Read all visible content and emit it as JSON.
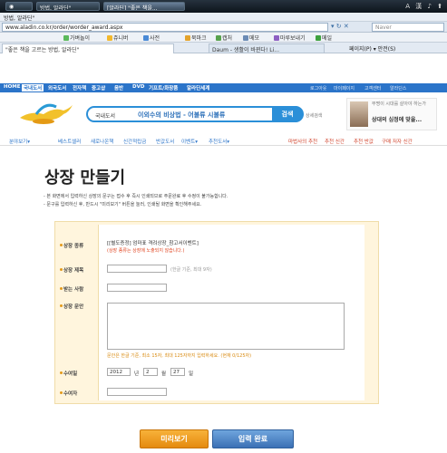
{
  "taskbar": {
    "items": [
      "방법, 알라딘\"",
      "[알라딘] \"좋은 책을..."
    ],
    "tray": "A 漢 ♪ ⬆"
  },
  "browser": {
    "title": "방법, 알라딘\"",
    "url": "www.aladin.co.kr/order/worder_award.aspx",
    "search_engine": "Naver",
    "toolbar": [
      "가벼놀이",
      "쥬니버",
      "사전",
      "북마크",
      "캡처",
      "메모",
      "마루보내기",
      "메일"
    ],
    "tab_active": "\"좋은 책을 고르는 방법, 알라딘\"",
    "tab_2": "Daum - 생활이 바뀐다! Li...",
    "command_bar": "페이지(P) ▾   안전(S)"
  },
  "site": {
    "nav": [
      "HOME",
      "국내도서",
      "외국도서",
      "전자책",
      "중고샵",
      "음반",
      "DVD",
      "기프트/화장품",
      "알라딘세계"
    ],
    "util": [
      "로그아웃",
      "마이페이지",
      "고객센터",
      "알라딘스"
    ],
    "search": {
      "category": "국내도서",
      "query": "이외수의 비상법 - 어불류 시불류",
      "button": "검색",
      "detail": "상세검색"
    },
    "ad": {
      "text": "무명이 시대를 살아야 하는가",
      "title": "상대의 심정에 맞을..."
    },
    "subnav": [
      "분야보기",
      "베스트셀러",
      "새로나온책",
      "신간적립금",
      "반값도서",
      "이벤트",
      "추천도서"
    ],
    "subnav_right": [
      "마법사의 추천",
      "추천 신간",
      "추천 반값",
      "구매 저자 신간"
    ]
  },
  "page": {
    "title": "상장 만들기",
    "notes": [
      "- 본 화면에서 입력하신 상장의 문구는 접수 후 즉시 인쇄되므로 주문완료 후 수정이 불가능합니다.",
      "- 문구를 입력하신 후, 반드시 \"미리보기\" 버튼을 눌러, 인쇄될 화면을 확인해주세요."
    ]
  },
  "form": {
    "type_label": "상장 종류",
    "type_value": "[[별도증정] 엄마표 격려상장_참고서이벤트]",
    "type_note": "(상장 종류는 상장에 노출되지 않습니다.)",
    "title_label": "상장 제목",
    "title_hint": "(한글 기준, 최대 9자)",
    "recipient_label": "받는 사람",
    "body_label": "상장 문안",
    "body_hint": "문안은 한글 기준, 최소 15자, 최대 125자까지 입력하세요. (현재 0/125자)",
    "date_label": "수여일",
    "date_year": "2012",
    "date_year_unit": "년",
    "date_month": "2",
    "date_month_unit": "월",
    "date_day": "27",
    "date_day_unit": "일",
    "giver_label": "수여자"
  },
  "buttons": {
    "preview": "미리보기",
    "submit": "입력 완료"
  }
}
